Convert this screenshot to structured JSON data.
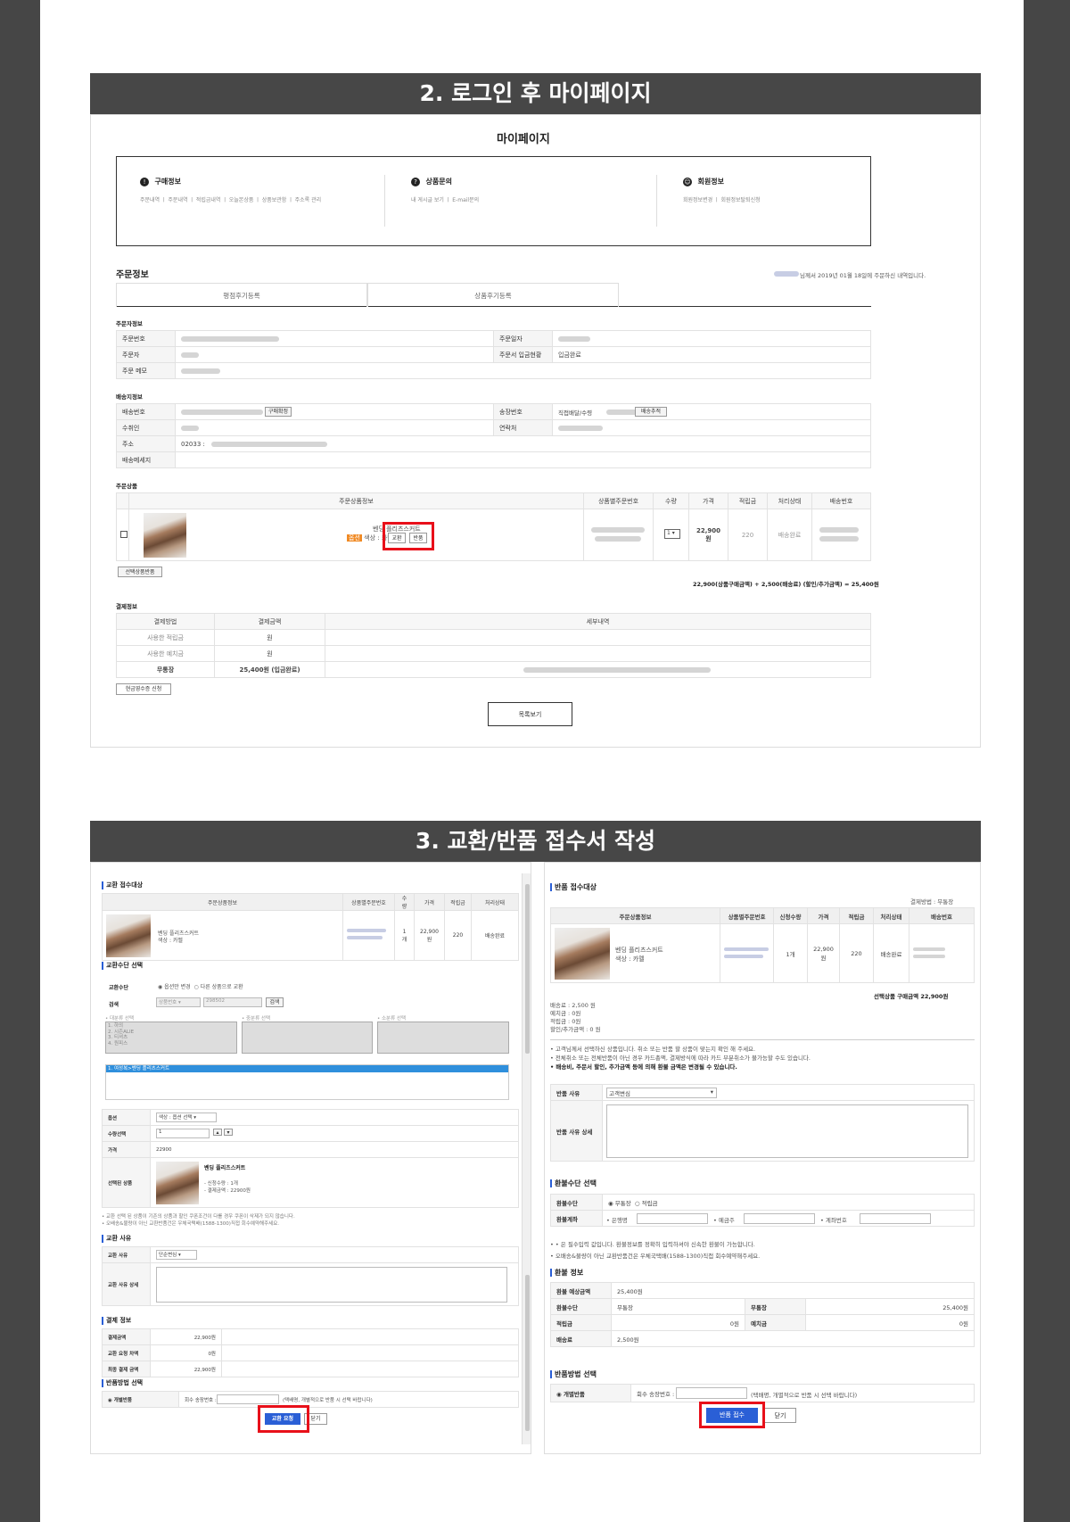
{
  "section2": {
    "title": "2. 로그인 후 마이페이지",
    "mypage_title": "마이페이지",
    "menu": [
      {
        "icon": "!",
        "label": "구매정보",
        "links": "주문내역 ㅣ 주문내역 ㅣ 적립금내역 ㅣ 오늘본상품 ㅣ 상품보관함 ㅣ 주소록 관리"
      },
      {
        "icon": "?",
        "label": "상품문의",
        "links": "내 게시글 보기 ㅣ E-mail문의"
      },
      {
        "icon": "☺",
        "label": "회원정보",
        "links": "회원정보변경 ㅣ 회원정보탈퇴신청"
      }
    ],
    "order_info_title": "주문정보",
    "order_notice": "님께서 2019년 01월 18일에 주문하신 내역입니다.",
    "review_tabs": [
      "평점후기등록",
      "상품후기등록"
    ],
    "orderer_title": "주문자정보",
    "orderer_labels": {
      "order_no": "주문번호",
      "order_date": "주문일자",
      "orderer": "주문자",
      "payment_status_label": "주문서 입금현황",
      "payment_status": "입금완료",
      "memo": "주문 메모"
    },
    "shipping_title": "배송지정보",
    "shipping_labels": {
      "ship_no": "배송번호",
      "track_no": "송장번호",
      "receiver": "수취인",
      "contact": "연락처",
      "address": "주소",
      "message": "배송메세지",
      "confirm_btn": "구매확정",
      "track_btn": "배송추적",
      "direct": "직접배달/수령",
      "zip": "02033 :"
    },
    "products_title": "주문상품",
    "product_headers": [
      "주문상품정보",
      "상품별주문번호",
      "수량",
      "가격",
      "적립금",
      "처리상태",
      "배송번호"
    ],
    "product": {
      "name": "벤딩 플리츠스커트",
      "option": "색상 : 카멜",
      "option_badge": "옵션",
      "exchange_btn": "교환",
      "return_btn": "반품",
      "qty": "1",
      "price": "22,900원",
      "points": "220",
      "status": "배송완료"
    },
    "selected_return_btn": "선택상품반품",
    "total_line": "22,900(상품구매금액) + 2,500(배송료) (할인/추가금액) = 25,400원",
    "payment_title": "결제정보",
    "payment_headers": [
      "결제방법",
      "결제금액",
      "세부내역"
    ],
    "payment_rows": [
      [
        "사용한 적립금",
        "원",
        ""
      ],
      [
        "사용한 예치금",
        "원",
        ""
      ],
      [
        "무통장",
        "25,400원 (입금완료)",
        ""
      ]
    ],
    "receipt_btn": "현금영수증 신청",
    "list_btn": "목록보기"
  },
  "section3": {
    "title": "3. 교환/반품 접수서 작성",
    "exchange": {
      "target_title": "교환 접수대상",
      "headers": [
        "주문상품정보",
        "상품별주문번호",
        "수량",
        "가격",
        "적립금",
        "처리상태"
      ],
      "product_name": "벤딩 플리츠스커트",
      "product_option": "색상 : 카멜",
      "qty": "1개",
      "price": "22,900원",
      "points": "220",
      "status": "배송완료",
      "method_title": "교환수단 선택",
      "method_label": "교환수단",
      "method_opt1": "옵션만 변경",
      "method_opt2": "다른 상품으로 교환",
      "search_label": "검색",
      "search_select": "상품번호",
      "search_value": "298502",
      "search_btn": "검색",
      "cat1": "• 대분류 선택",
      "cat2": "• 중분류 선택",
      "cat3": "• 소분류 선택",
      "cat_items": [
        "1. 하의",
        "2. 시즌ALIE",
        "3. 티셔츠",
        "4. 원피스"
      ],
      "result_item": "1. 여성복>벤딩 플리츠스커트",
      "option_label": "옵션",
      "option_value": "색상 : 옵션 선택",
      "qty_label": "수량선택",
      "qty_value": "1",
      "price_label": "가격",
      "price_value": "22900",
      "selected_label": "선택된 상품",
      "sel_name": "벤딩 플리츠스커트",
      "sel_qty": "- 신청수량 : 1개",
      "sel_amount": "- 결제금액 : 22900원",
      "notice1": "• 교환 선택 된 상품이 기존의 상품과 할인 쿠폰조건이 다를 경우 쿠폰이 삭제가 되지 않습니다.",
      "notice2": "• 오배송&불량이 아닌 교환반품건은 우체국택배(1588-1300)직접 회수예약해주세요.",
      "reason_title": "교환 사유",
      "reason_label": "교환 사유",
      "reason_value": "단순변심",
      "reason_detail_label": "교환 사유 상세",
      "pay_title": "결제 정보",
      "pay_rows": [
        [
          "결제금액",
          "22,900원"
        ],
        [
          "교환 요청 차액",
          "0원"
        ],
        [
          "최종 결제 금액",
          "22,900원"
        ]
      ],
      "ship_title": "반품방법 선택",
      "ship_opt": "개별반품",
      "ship_track": "회수 송장번호 :",
      "ship_hint": "(택배명, 개별적으로 반품 시 선택 바랍니다)",
      "submit_btn": "교환 요청",
      "close_btn": "닫기"
    },
    "return": {
      "target_title": "반품 접수대상",
      "pay_method": "결제방법 : 무통장",
      "headers": [
        "주문상품정보",
        "상품별주문번호",
        "신청수량",
        "가격",
        "적립금",
        "처리상태",
        "배송번호"
      ],
      "product_name": "벤딩 플리츠스커트",
      "product_option": "색상 : 카멜",
      "qty": "1개",
      "price": "22,900원",
      "points": "220",
      "status": "배송완료",
      "sum": "선택상품 구매금액 22,900원",
      "fees": [
        "배송료 : 2,500 원",
        "예치금 : 0원",
        "적립금 : 0원",
        "할인/추가금액 : 0 원"
      ],
      "notices": [
        "• 고객님께서 선택하신 상품입니다. 취소 또는 반품 할 상품이 맞는지 확인 해 주세요.",
        "• 전체취소 또는 전체반품이 아닌 경우 카드총액, 결제방식에 따라 카드 부분취소가 불가능할 수도 있습니다.",
        "• 배송비, 주문서 할인, 추가금액 등에 의해 환불 금액은 변경될 수 있습니다."
      ],
      "reason_label": "반품 사유",
      "reason_value": "고객변심",
      "reason_detail_label": "반품 사유 상세",
      "refund_title": "환불수단 선택",
      "refund_label": "환불수단",
      "refund_opt1": "무통장",
      "refund_opt2": "적립금",
      "account_label": "환불계좌",
      "bank": "• 은행명",
      "holder": "• 예금주",
      "account_no": "• 계좌번호",
      "refund_notice1": "• • 은 필수입력 값입니다. 환불정보를 정확히 입력하셔야 신속한 환불이 가능합니다.",
      "refund_notice2": "• 오배송&불량이 아닌 교환반품건은 우체국택배(1588-1300)직접 회수예약해주세요.",
      "info_title": "환불 정보",
      "info_rows": [
        [
          "환불 예상금액",
          "25,400원",
          "",
          ""
        ],
        [
          "환불수단",
          "무통장",
          "무통장",
          "25,400원"
        ],
        [
          "적립금",
          "0원",
          "예치금",
          "0원"
        ],
        [
          "배송료",
          "2,500원",
          "",
          ""
        ]
      ],
      "ship_title": "반품방법 선택",
      "ship_opt": "개별반품",
      "ship_track": "회수 송장번호 :",
      "ship_hint": "(택배명, 개별적으로 반품 시 선택 바랍니다)",
      "submit_btn": "반품 접수",
      "close_btn": "닫기"
    }
  }
}
